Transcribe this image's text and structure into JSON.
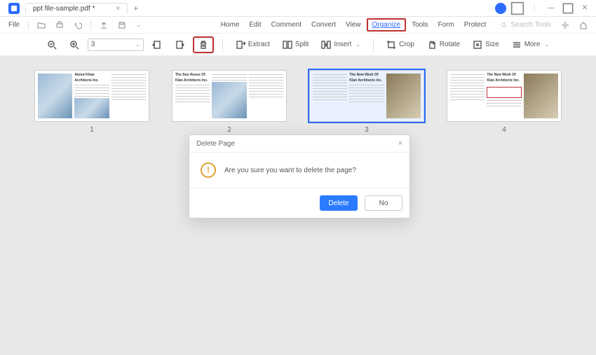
{
  "titlebar": {
    "tab": "ppt file-sample.pdf *",
    "tab_close": "×",
    "plus": "+"
  },
  "file_menu": "File",
  "main_menu": [
    "Home",
    "Edit",
    "Comment",
    "Convert",
    "View",
    "Organize",
    "Tools",
    "Form",
    "Protect"
  ],
  "main_menu_active_index": 5,
  "search_placeholder": "Search Tools",
  "toolbar": {
    "page_value": "3",
    "extract": "Extract",
    "split": "Split",
    "insert": "Insert",
    "crop": "Crop",
    "rotate": "Rotate",
    "size": "Size",
    "more": "More"
  },
  "pages": [
    {
      "num": "1",
      "title1": "About Khan",
      "title2": "Architects Inc."
    },
    {
      "num": "2",
      "title1": "The Sea House Of",
      "title2": "Klan Architects Inc."
    },
    {
      "num": "3",
      "title1": "The New Work Of",
      "title2": "Klan Architects Inc."
    },
    {
      "num": "4",
      "title1": "The New Work Of",
      "title2": "Klan Architects Inc."
    }
  ],
  "selected_page_index": 2,
  "dialog": {
    "title": "Delete Page",
    "message": "Are you sure you want to delete the page?",
    "confirm": "Delete",
    "cancel": "No",
    "close": "×"
  }
}
